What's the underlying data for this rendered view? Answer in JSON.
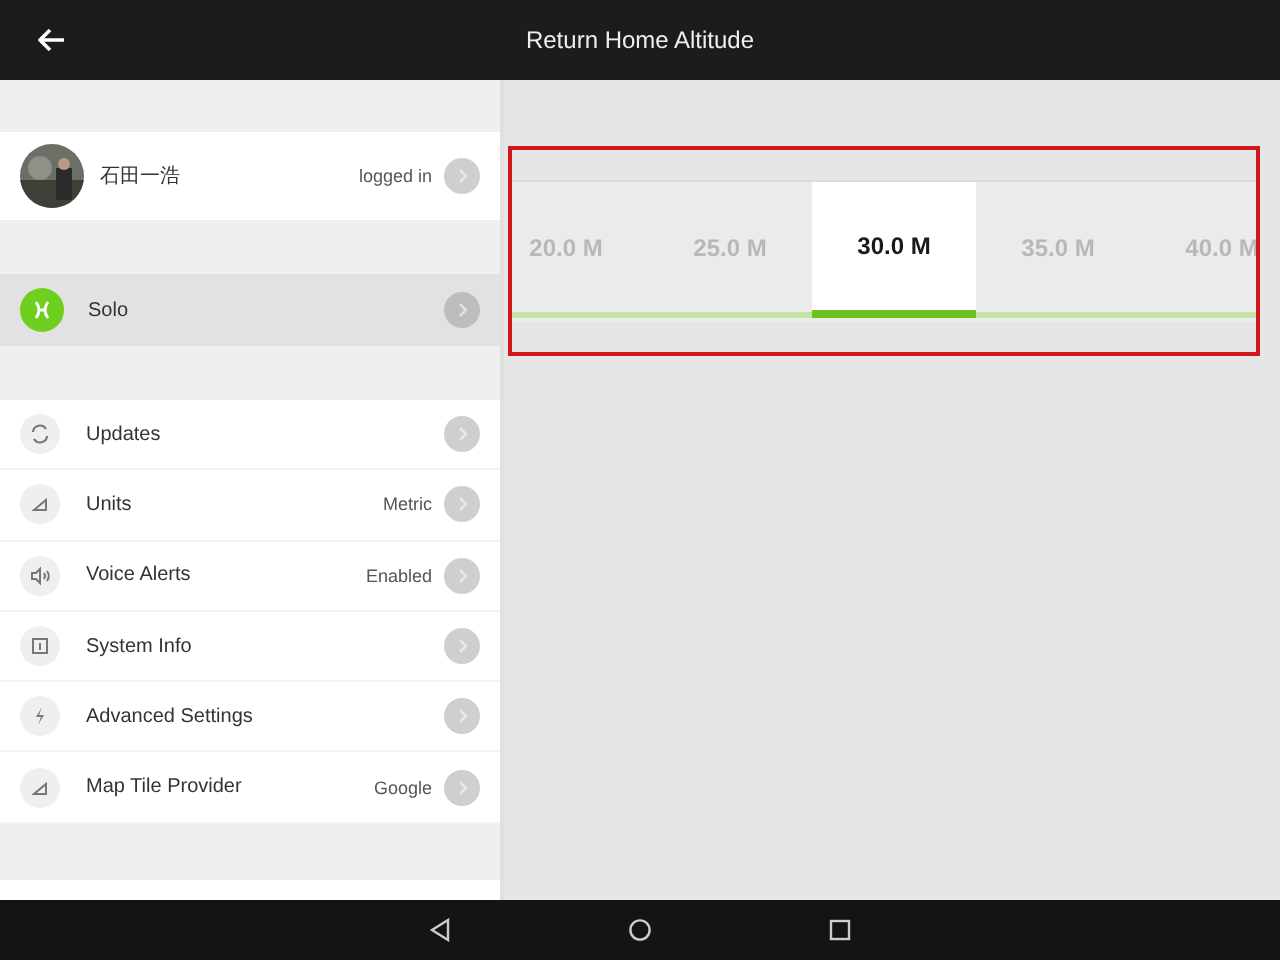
{
  "top_bar": {
    "title": "Return Home Altitude"
  },
  "account": {
    "name": "石田一浩",
    "status": "logged in"
  },
  "device": {
    "name": "Solo",
    "selected": true
  },
  "settings": [
    {
      "kind": "updates",
      "label": "Updates"
    },
    {
      "kind": "units",
      "label": "Units",
      "value": "Metric"
    },
    {
      "kind": "voice",
      "label": "Voice Alerts",
      "value": "Enabled"
    },
    {
      "kind": "info",
      "label": "System Info"
    },
    {
      "kind": "advanced",
      "label": "Advanced Settings"
    },
    {
      "kind": "map",
      "label": "Map Tile Provider",
      "value": "Google"
    }
  ],
  "altitude_options": [
    {
      "label": "20.0 M",
      "selected": false
    },
    {
      "label": "25.0 M",
      "selected": false
    },
    {
      "label": "30.0 M",
      "selected": true
    },
    {
      "label": "35.0 M",
      "selected": false
    },
    {
      "label": "40.0 M",
      "selected": false
    }
  ]
}
